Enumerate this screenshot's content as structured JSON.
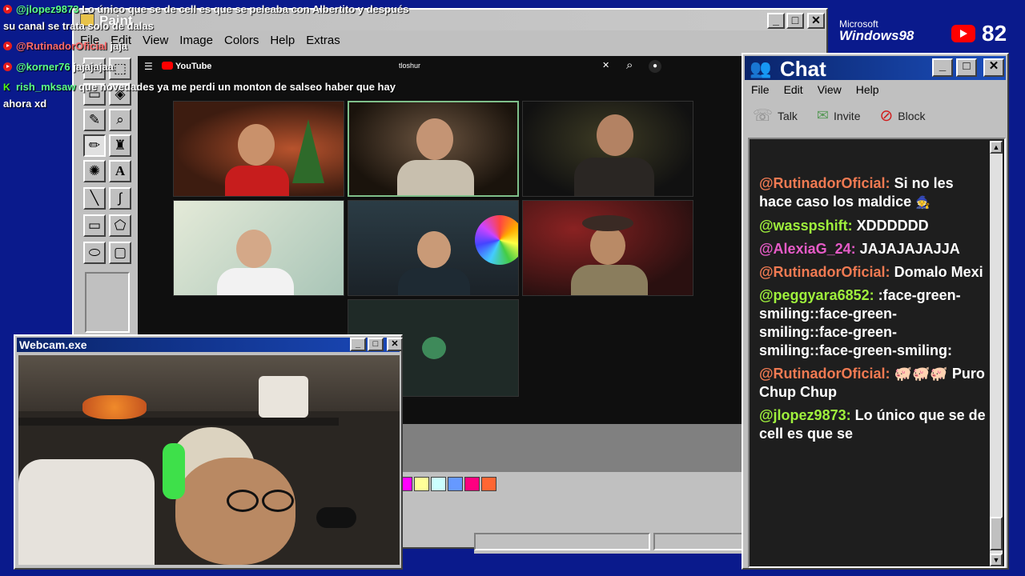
{
  "overlay_chat": [
    {
      "user": "@jlopez9873",
      "text": "Lo único que se de cell es que se peleaba con Albertito y después"
    },
    {
      "user": "",
      "text": "su canal se trata solo de dalas"
    },
    {
      "user": "@RutinadorOficial",
      "text": "jaja"
    },
    {
      "user": "@korner76",
      "text": "jajajajaa"
    },
    {
      "user": "rish_mksaw",
      "text": "que novedades ya me perdi un monton de salseo haber que hay"
    },
    {
      "user": "",
      "text": "ahora xd"
    }
  ],
  "paint": {
    "title": "Paint",
    "menu": [
      "File",
      "Edit",
      "View",
      "Image",
      "Colors",
      "Help",
      "Extras"
    ],
    "btn_min": "_",
    "btn_max": "□",
    "btn_close": "✕"
  },
  "browser": {
    "logo": "YouTube",
    "search_value": "tloshur",
    "clear": "✕",
    "search_icon": "⌕",
    "mic_icon": "🎤"
  },
  "palette": [
    "#ffff00",
    "#00cc00",
    "#00ffff",
    "#0000ff",
    "#ff00ff",
    "#ffff99",
    "#ccffff",
    "#6699ff",
    "#ff0080",
    "#ff6633"
  ],
  "webcam": {
    "title": "Webcam.exe",
    "btn_min": "_",
    "btn_max": "□",
    "btn_close": "✕"
  },
  "chat": {
    "title": "Chat",
    "menu": [
      "File",
      "Edit",
      "View",
      "Help"
    ],
    "tools": [
      {
        "label": "Talk",
        "icon": "talk-icon"
      },
      {
        "label": "Invite",
        "icon": "invite-icon"
      },
      {
        "label": "Block",
        "icon": "block-icon"
      }
    ],
    "messages": [
      {
        "user": "@RutinadorOficial:",
        "text": "Si no les hace caso los maldice",
        "color": "#f07a52"
      },
      {
        "user": "@wasspshift:",
        "text": "XDDDDDD",
        "color": "#9ff03c"
      },
      {
        "user": "@AlexiaG_24:",
        "text": "JAJAJAJAJJA",
        "color": "#e65bc7"
      },
      {
        "user": "@RutinadorOficial:",
        "text": "Domalo Mexi",
        "color": "#f07a52"
      },
      {
        "user": "@peggyara6852:",
        "text": ":face-green-smiling::face-green-smiling::face-green-smiling::face-green-smiling:",
        "color": "#9ff03c"
      },
      {
        "user": "@RutinadorOficial:",
        "text": "🐖🐖🐖 Puro Chup Chup",
        "color": "#f07a52"
      },
      {
        "user": "@jlopez9873:",
        "text": "Lo único que se de cell es que se",
        "color": "#9ff03c"
      }
    ]
  },
  "windows_logo": {
    "line1": "Microsoft",
    "line2": "Windows98"
  },
  "viewer_count": "82"
}
